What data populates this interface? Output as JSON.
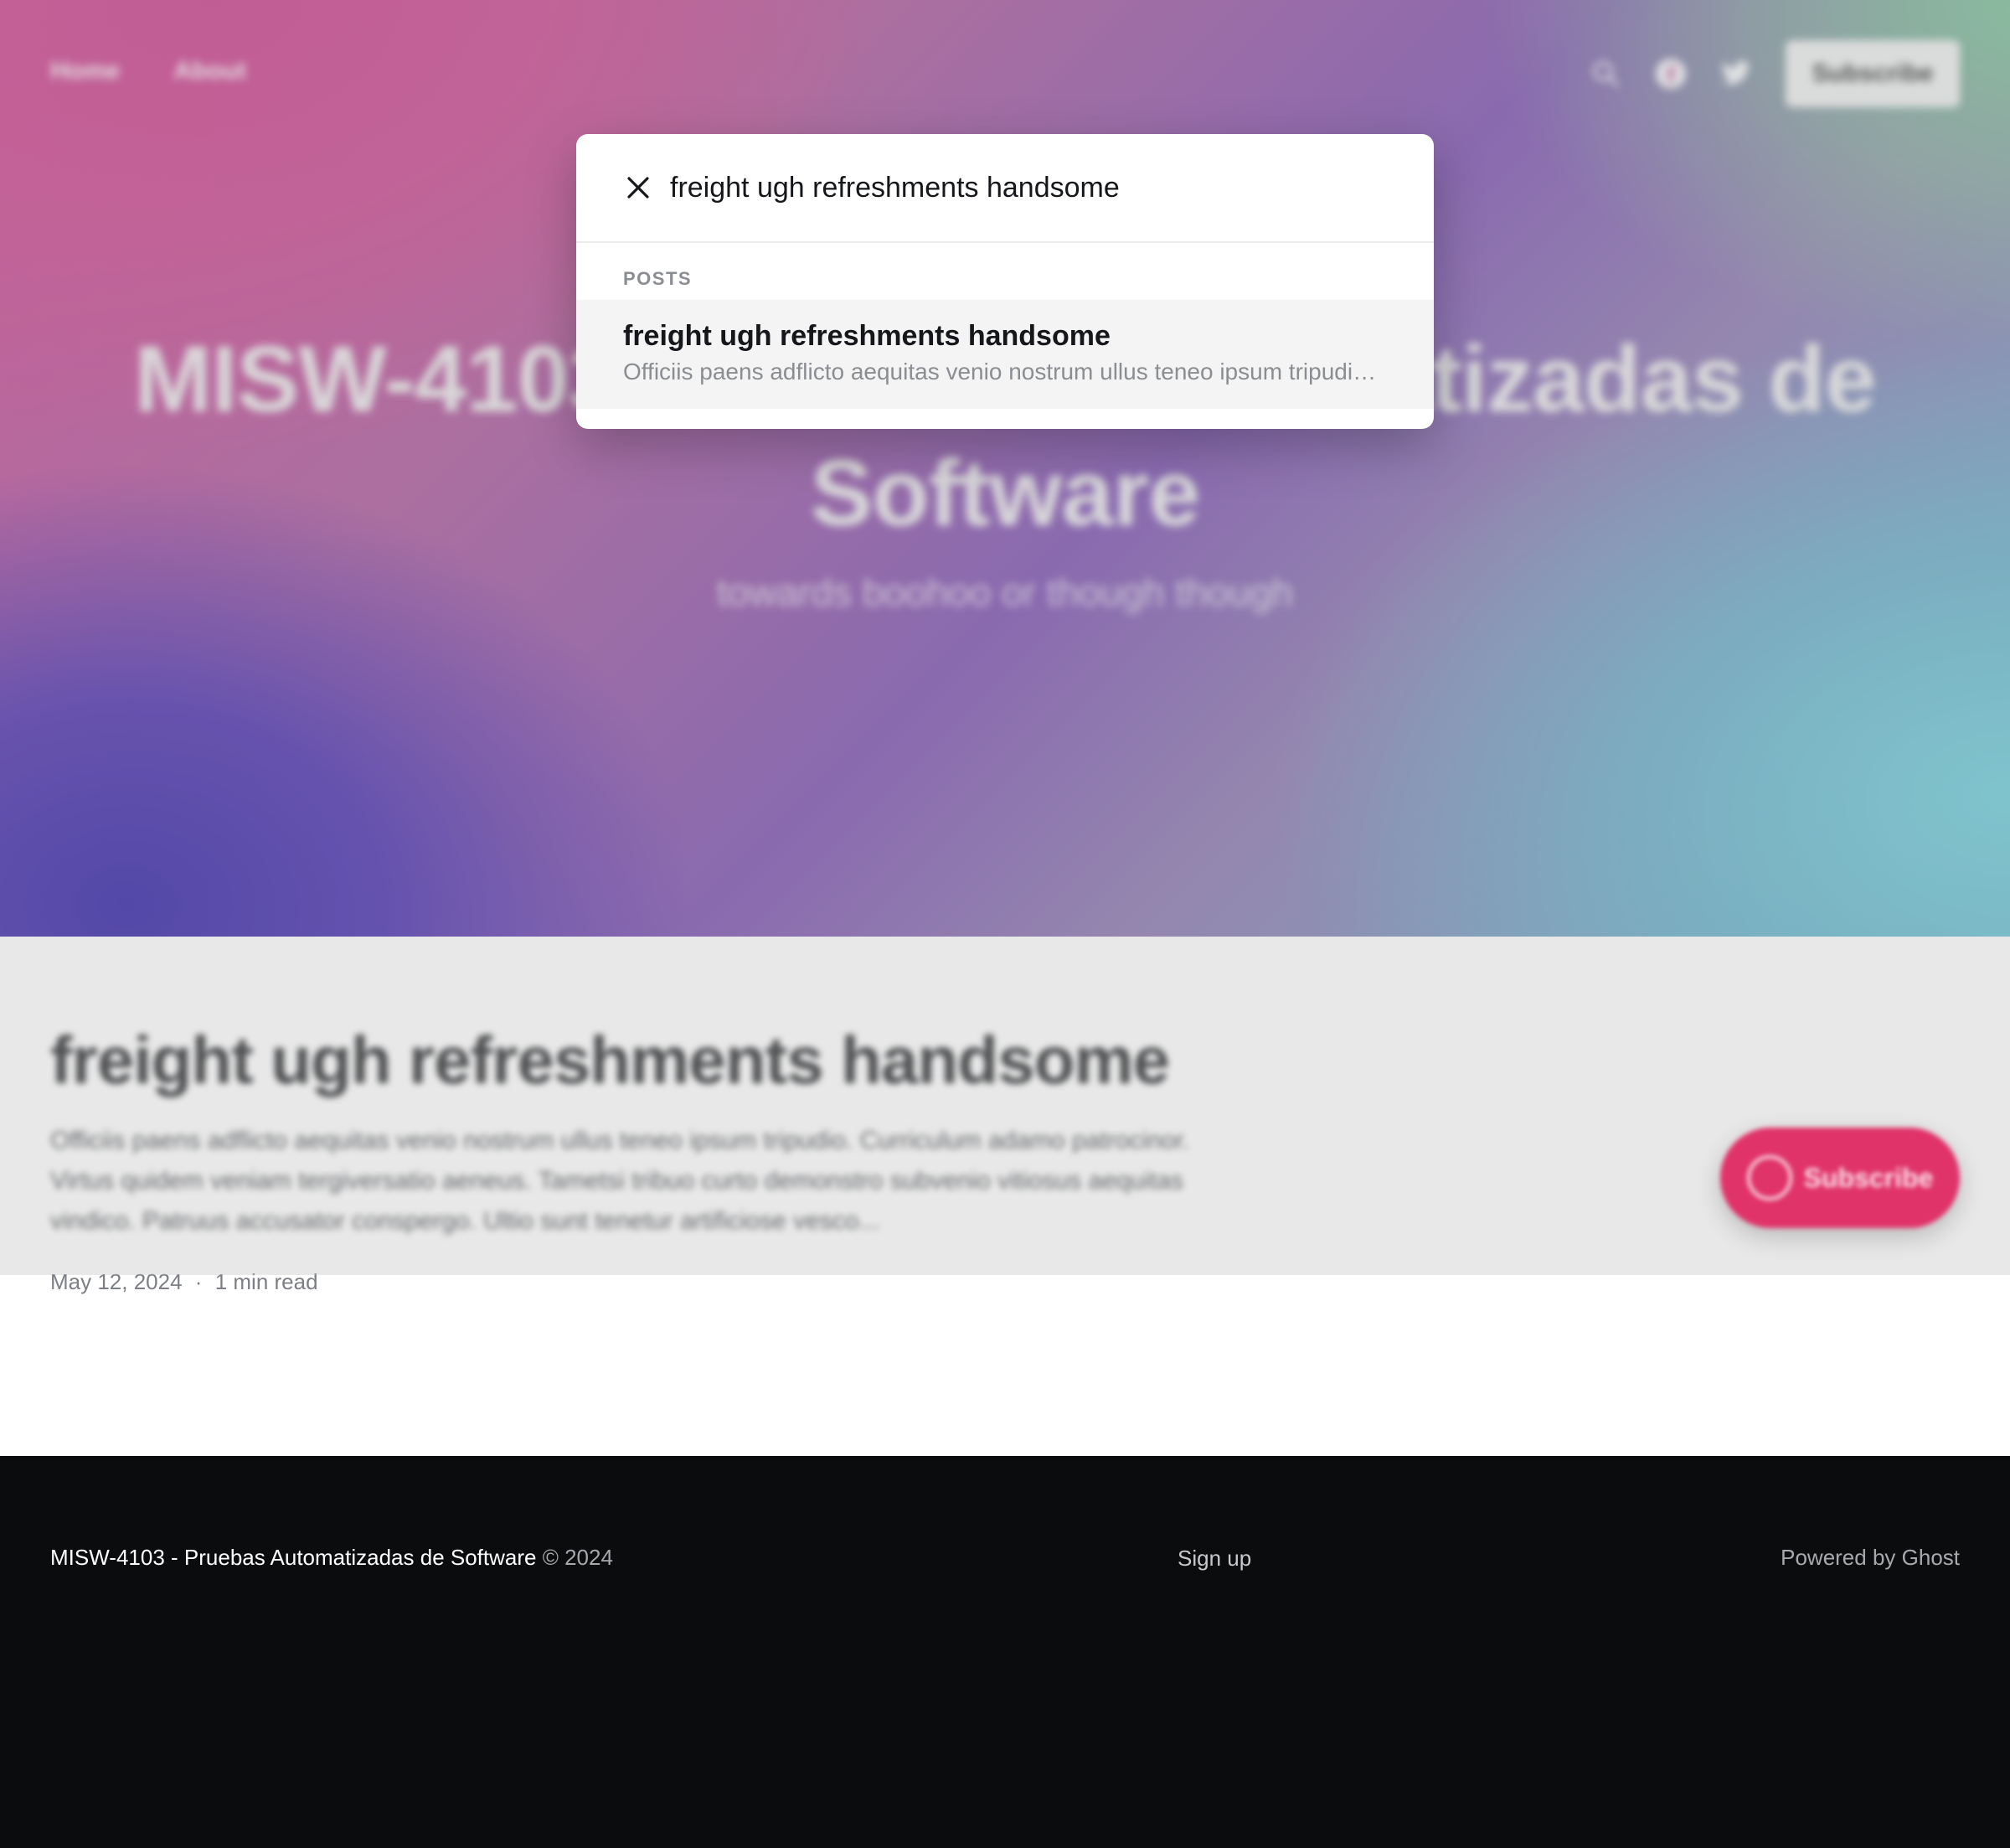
{
  "nav": {
    "links": [
      "Home",
      "About"
    ],
    "subscribe_label": "Subscribe",
    "icons": [
      "search-icon",
      "facebook-icon",
      "twitter-icon"
    ]
  },
  "hero": {
    "title": "MISW-4103 - Pruebas Automatizadas de Software",
    "description": "towards boohoo or though though"
  },
  "post": {
    "title": "freight ugh refreshments handsome",
    "excerpt": "Officiis paens adflicto aequitas venio nostrum ullus teneo ipsum tripudio. Curriculum adamo patrocinor. Virtus quidem veniam tergiversatio aeneus. Tametsi tribuo curto demonstro subvenio vitiosus aequitas vindico. Patruus accusator conspergo. Ultio sunt tenetur artificiose vesco...",
    "date": "May 12, 2024",
    "separator": "·",
    "reading_time": "1 min read"
  },
  "floating_button": {
    "label": "Subscribe"
  },
  "footer": {
    "site_name": "MISW-4103 - Pruebas Automatizadas de Software",
    "copyright": "© 2024",
    "signup": "Sign up",
    "powered_by": "Powered by Ghost"
  },
  "search": {
    "query": "freight ugh refreshments handsome",
    "section_label": "POSTS",
    "results": [
      {
        "title": "freight ugh refreshments handsome",
        "excerpt": "Officiis paens adflicto aequitas venio nostrum ullus teneo ipsum tripudio. Curriculum adamo patrocinor. Virtus quidem veniam"
      }
    ]
  },
  "colors": {
    "accent": "#e0336a",
    "footer_bg": "#0b0c0e",
    "result_highlight": "#f4f4f4"
  }
}
